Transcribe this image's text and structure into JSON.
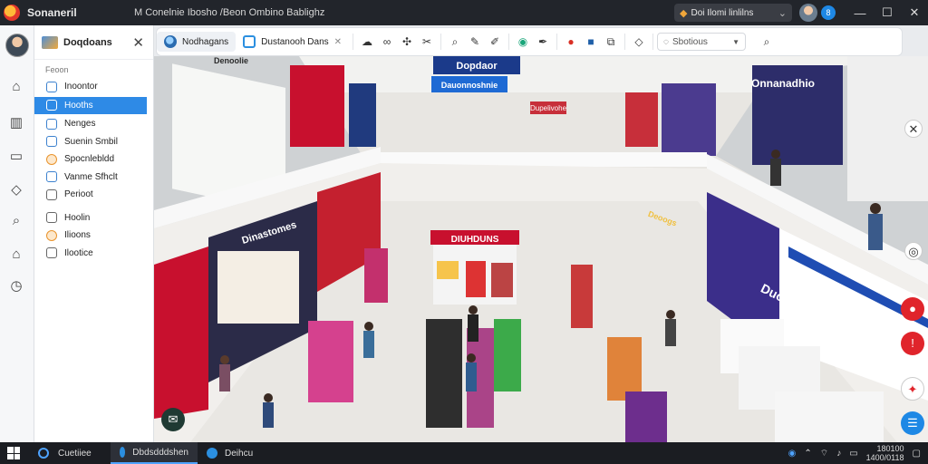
{
  "titlebar": {
    "app_name": "Sonaneril",
    "menu_text": "M  Conelnie  Ibosho  /Beon  Ombino  Bablighz",
    "extension_label": "Doi Ilomi linlilns",
    "notify_count": "8",
    "min_symbol": "—",
    "max_symbol": "☐",
    "close_symbol": "✕"
  },
  "sidebar": {
    "title": "Doqdoans",
    "close_symbol": "✕",
    "section_label": "Feoon",
    "items": [
      {
        "label": "Inoontor",
        "icon": "document-icon"
      },
      {
        "label": "Hooths",
        "icon": "home-icon",
        "active": true
      },
      {
        "label": "Nenges",
        "icon": "image-icon"
      },
      {
        "label": "Suenin Smbil",
        "icon": "chat-icon"
      },
      {
        "label": "Spocnlebldd",
        "icon": "sun-icon"
      },
      {
        "label": "Vanme Sfhclt",
        "icon": "calendar-icon"
      },
      {
        "label": "Perioot",
        "icon": "file-icon"
      },
      {
        "label": "Hoolin",
        "icon": "clock-icon"
      },
      {
        "label": "Ilioons",
        "icon": "star-icon"
      },
      {
        "label": "Ilootice",
        "icon": "note-icon"
      }
    ]
  },
  "toolbar": {
    "tabs": [
      {
        "label": "Nodhagans"
      },
      {
        "label": "Dustanooh Dans"
      }
    ],
    "tab_close_symbol": "✕",
    "select_value": "Sbotious"
  },
  "mall": {
    "hero_sign": "Dopdaor",
    "banner_1": "Dauonnoshnie",
    "banner_2": "Dupelivohe",
    "top_left_store": "Denoolie",
    "left_wing_store": "Dinastomes",
    "center_kiosk": "DIUHDUNS",
    "right_wing_store": "Deoogs",
    "right_sign": "Onnanadhio",
    "right_lower_sign": "Duocar"
  },
  "taskbar": {
    "search_label": "Cuetiiee",
    "apps": [
      {
        "label": "Dbdsdddshen",
        "active": true
      },
      {
        "label": "Deihcu",
        "active": false
      }
    ],
    "clock_time": "180100",
    "clock_date": "1400/0118"
  },
  "colors": {
    "accent": "#2e8ae6",
    "titlebar": "#22252b",
    "taskbar": "#1b1d22"
  }
}
